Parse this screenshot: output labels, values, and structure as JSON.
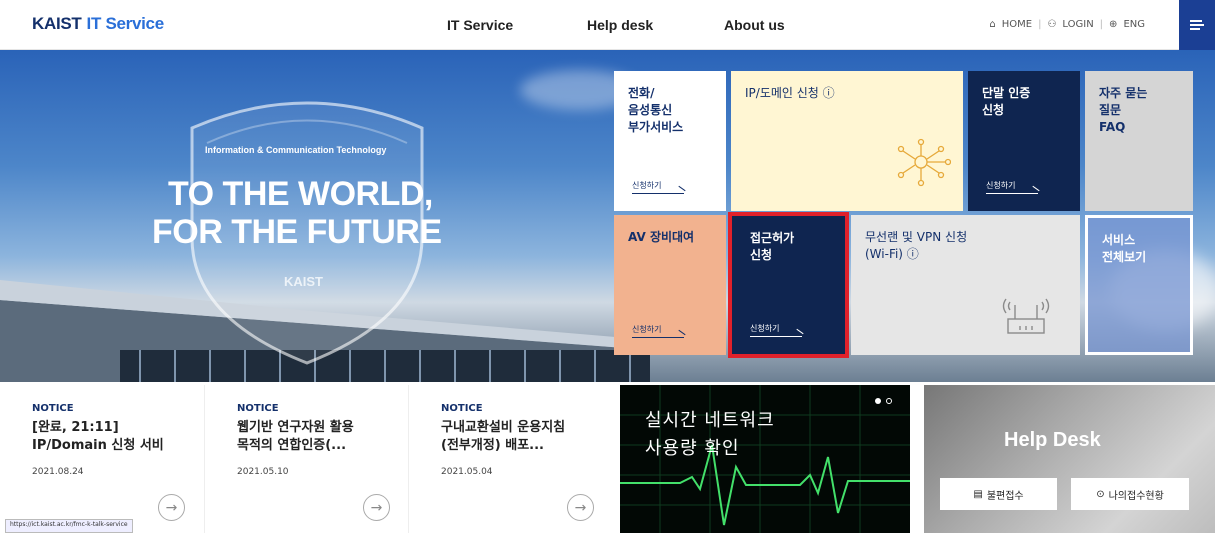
{
  "header": {
    "logo_main": "KAIST",
    "logo_sub": "IT Service",
    "nav": [
      "IT Service",
      "Help desk",
      "About us"
    ],
    "util_home": "HOME",
    "util_login": "LOGIN",
    "util_lang": "ENG"
  },
  "hero": {
    "tagline": "Information & Communication Technology",
    "line1": "TO THE WORLD,",
    "line2": "FOR THE FUTURE",
    "shield_text": "KAIST"
  },
  "tiles": {
    "phone": {
      "title": "전화/\n음성통신\n부가서비스",
      "apply": "신청하기"
    },
    "ip": {
      "title": "IP/도메인 신청 ⓘ"
    },
    "device": {
      "title": "단말 인증\n신청",
      "apply": "신청하기"
    },
    "faq": {
      "title": "자주 묻는\n질문\nFAQ"
    },
    "av": {
      "title": "AV 장비대여",
      "apply": "신청하기"
    },
    "access": {
      "title": "접근허가\n신청",
      "apply": "신청하기"
    },
    "wlan": {
      "title": "무선랜 및 VPN 신청\n(Wi-Fi) ⓘ"
    },
    "all": {
      "title": "서비스\n전체보기"
    }
  },
  "notices": [
    {
      "label": "NOTICE",
      "title": "[완료, 21:11]\nIP/Domain 신청 서비",
      "date": "2021.08.24"
    },
    {
      "label": "NOTICE",
      "title": "웹기반 연구자원 활용\n목적의 연합인증(...",
      "date": "2021.05.10"
    },
    {
      "label": "NOTICE",
      "title": "구내교환설비 운용지침\n(전부개정) 배포...",
      "date": "2021.05.04"
    }
  ],
  "network": {
    "title": "실시간 네트워크\n사용량 확인"
  },
  "helpdesk": {
    "title": "Help Desk",
    "btn_report": "불편접수",
    "btn_status": "나의접수현황"
  },
  "statusbar": "https://ict.kaist.ac.kr/fmc-k-talk-service",
  "colors": {
    "navy": "#14306b",
    "tile_navy": "#0f2550",
    "cream": "#fff6d3",
    "salmon": "#f2b28f",
    "gray": "#e6e6e6",
    "lightgray": "#d5d5d5",
    "highlight": "#e0212b"
  }
}
